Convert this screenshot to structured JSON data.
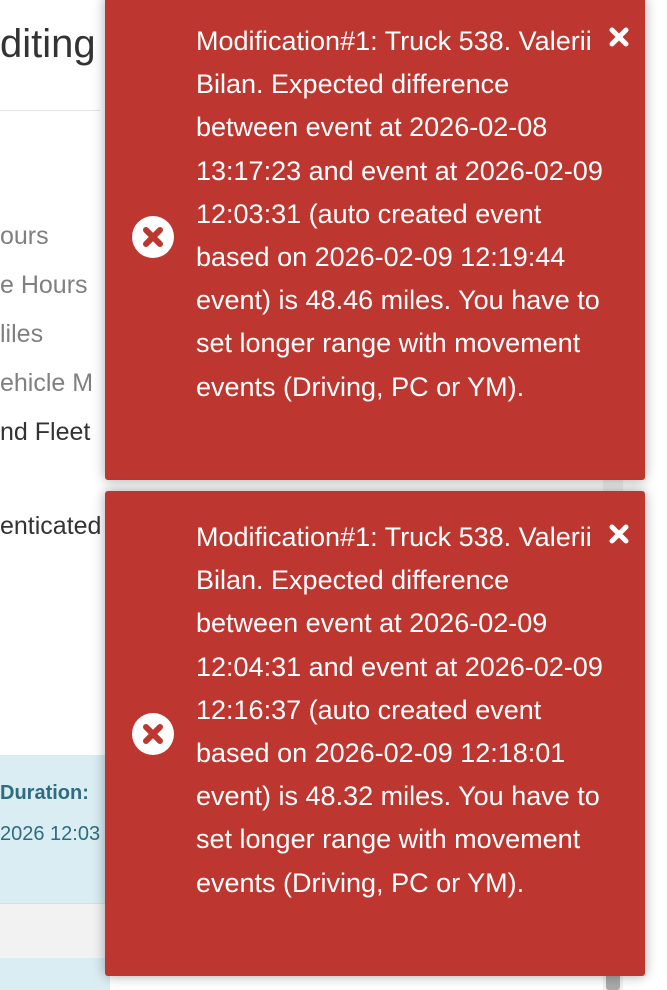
{
  "background": {
    "title": "diting T",
    "menu_items": [
      "ours",
      "e Hours",
      "liles",
      "ehicle M",
      "nd Fleet",
      "enticated"
    ],
    "panel": {
      "label": "Duration:",
      "value": "2026 12:03"
    }
  },
  "toasts": [
    {
      "type": "error",
      "icon": "error-circle-x-icon",
      "close_icon": "close-icon",
      "message": "Modification#1: Truck 538. Valerii Bilan. Expected difference between event at 2026-02-08 13:17:23 and event at 2026-02-09 12:03:31 (auto created event based on 2026-02-09 12:19:44 event) is 48.46 miles. You have to set longer range with movement events (Driving, PC or YM)."
    },
    {
      "type": "error",
      "icon": "error-circle-x-icon",
      "close_icon": "close-icon",
      "message": "Modification#1: Truck 538. Valerii Bilan. Expected difference between event at 2026-02-09 12:04:31 and event at 2026-02-09 12:16:37 (auto created event based on 2026-02-09 12:18:01 event) is 48.32 miles. You have to set longer range with movement events (Driving, PC or YM)."
    }
  ],
  "colors": {
    "toast_error_bg": "#bd362f",
    "toast_text": "#ffffff",
    "panel_bg": "#d9edf3",
    "panel_text": "#2f6c80"
  }
}
